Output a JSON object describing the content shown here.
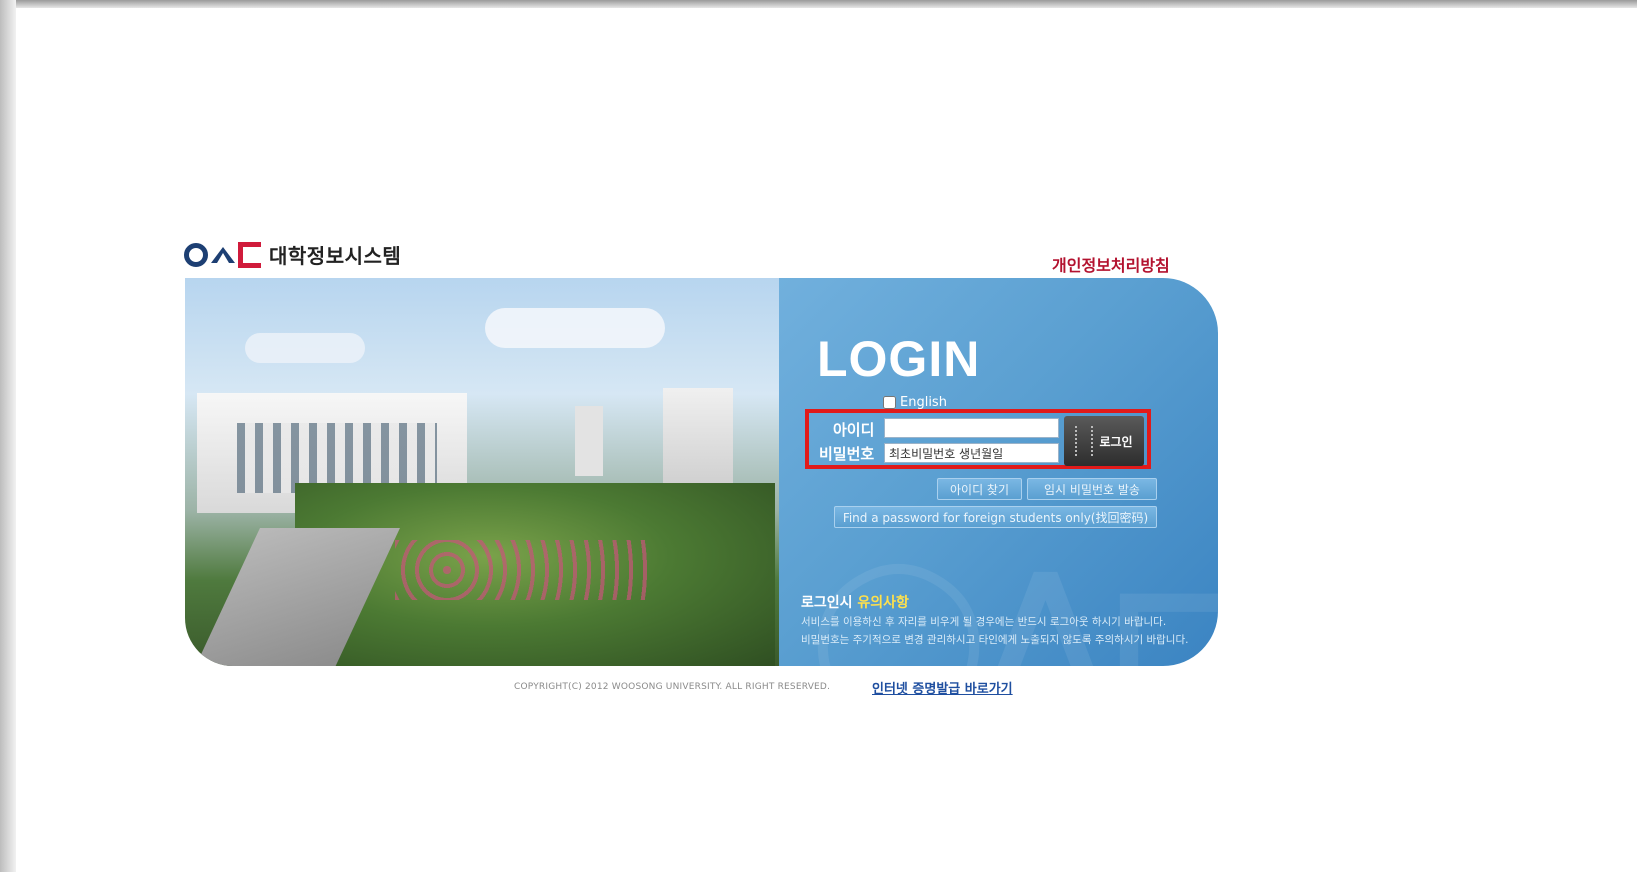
{
  "brand": {
    "logo_letters": "OAC",
    "system_name": "대학정보시스템"
  },
  "header": {
    "privacy_link": "개인정보처리방침"
  },
  "login": {
    "title": "LOGIN",
    "english_label": "English",
    "id_label": "아이디",
    "password_label": "비밀번호",
    "id_value": "",
    "password_placeholder": "최초비밀번호 생년월일",
    "login_button": "로그인",
    "find_id_button": "아이디 찾기",
    "temp_password_button": "임시 비밀번호 발송",
    "foreign_password_button": "Find a password for foreign students only(找回密码)"
  },
  "notice": {
    "title_prefix": "로그인시",
    "title_highlight": "유의사항",
    "lines": [
      "서비스를 이용하신 후 자리를 비우게 될 경우에는 반드시 로그아웃 하시기 바랍니다.",
      "비밀번호는 주기적으로 변경 관리하시고 타인에게 노출되지 않도록 주의하시기 바랍니다."
    ]
  },
  "footer": {
    "copyright": "COPYRIGHT(C) 2012 WOOSONG UNIVERSITY.  ALL RIGHT RESERVED.",
    "certificate_link": "인터넷 증명발급 바로가기"
  },
  "colors": {
    "brand_navy": "#1d3f73",
    "brand_red": "#d01b3b",
    "panel_blue": "#5a9fd1",
    "highlight_red": "#e11a1a"
  },
  "icons": [
    "logo-icon",
    "key-icon",
    "checkbox-icon"
  ]
}
